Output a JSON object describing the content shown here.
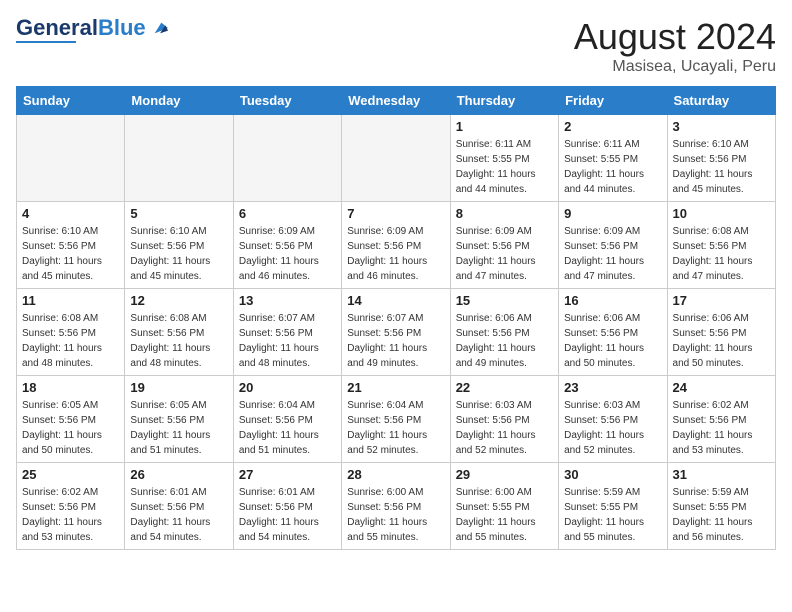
{
  "header": {
    "logo_line1": "General",
    "logo_line2": "Blue",
    "title": "August 2024",
    "subtitle": "Masisea, Ucayali, Peru"
  },
  "days_of_week": [
    "Sunday",
    "Monday",
    "Tuesday",
    "Wednesday",
    "Thursday",
    "Friday",
    "Saturday"
  ],
  "weeks": [
    [
      {
        "day": "",
        "empty": true
      },
      {
        "day": "",
        "empty": true
      },
      {
        "day": "",
        "empty": true
      },
      {
        "day": "",
        "empty": true
      },
      {
        "day": "1",
        "sunrise": "6:11 AM",
        "sunset": "5:55 PM",
        "daylight": "11 hours and 44 minutes."
      },
      {
        "day": "2",
        "sunrise": "6:11 AM",
        "sunset": "5:55 PM",
        "daylight": "11 hours and 44 minutes."
      },
      {
        "day": "3",
        "sunrise": "6:10 AM",
        "sunset": "5:56 PM",
        "daylight": "11 hours and 45 minutes."
      }
    ],
    [
      {
        "day": "4",
        "sunrise": "6:10 AM",
        "sunset": "5:56 PM",
        "daylight": "11 hours and 45 minutes."
      },
      {
        "day": "5",
        "sunrise": "6:10 AM",
        "sunset": "5:56 PM",
        "daylight": "11 hours and 45 minutes."
      },
      {
        "day": "6",
        "sunrise": "6:09 AM",
        "sunset": "5:56 PM",
        "daylight": "11 hours and 46 minutes."
      },
      {
        "day": "7",
        "sunrise": "6:09 AM",
        "sunset": "5:56 PM",
        "daylight": "11 hours and 46 minutes."
      },
      {
        "day": "8",
        "sunrise": "6:09 AM",
        "sunset": "5:56 PM",
        "daylight": "11 hours and 47 minutes."
      },
      {
        "day": "9",
        "sunrise": "6:09 AM",
        "sunset": "5:56 PM",
        "daylight": "11 hours and 47 minutes."
      },
      {
        "day": "10",
        "sunrise": "6:08 AM",
        "sunset": "5:56 PM",
        "daylight": "11 hours and 47 minutes."
      }
    ],
    [
      {
        "day": "11",
        "sunrise": "6:08 AM",
        "sunset": "5:56 PM",
        "daylight": "11 hours and 48 minutes."
      },
      {
        "day": "12",
        "sunrise": "6:08 AM",
        "sunset": "5:56 PM",
        "daylight": "11 hours and 48 minutes."
      },
      {
        "day": "13",
        "sunrise": "6:07 AM",
        "sunset": "5:56 PM",
        "daylight": "11 hours and 48 minutes."
      },
      {
        "day": "14",
        "sunrise": "6:07 AM",
        "sunset": "5:56 PM",
        "daylight": "11 hours and 49 minutes."
      },
      {
        "day": "15",
        "sunrise": "6:06 AM",
        "sunset": "5:56 PM",
        "daylight": "11 hours and 49 minutes."
      },
      {
        "day": "16",
        "sunrise": "6:06 AM",
        "sunset": "5:56 PM",
        "daylight": "11 hours and 50 minutes."
      },
      {
        "day": "17",
        "sunrise": "6:06 AM",
        "sunset": "5:56 PM",
        "daylight": "11 hours and 50 minutes."
      }
    ],
    [
      {
        "day": "18",
        "sunrise": "6:05 AM",
        "sunset": "5:56 PM",
        "daylight": "11 hours and 50 minutes."
      },
      {
        "day": "19",
        "sunrise": "6:05 AM",
        "sunset": "5:56 PM",
        "daylight": "11 hours and 51 minutes."
      },
      {
        "day": "20",
        "sunrise": "6:04 AM",
        "sunset": "5:56 PM",
        "daylight": "11 hours and 51 minutes."
      },
      {
        "day": "21",
        "sunrise": "6:04 AM",
        "sunset": "5:56 PM",
        "daylight": "11 hours and 52 minutes."
      },
      {
        "day": "22",
        "sunrise": "6:03 AM",
        "sunset": "5:56 PM",
        "daylight": "11 hours and 52 minutes."
      },
      {
        "day": "23",
        "sunrise": "6:03 AM",
        "sunset": "5:56 PM",
        "daylight": "11 hours and 52 minutes."
      },
      {
        "day": "24",
        "sunrise": "6:02 AM",
        "sunset": "5:56 PM",
        "daylight": "11 hours and 53 minutes."
      }
    ],
    [
      {
        "day": "25",
        "sunrise": "6:02 AM",
        "sunset": "5:56 PM",
        "daylight": "11 hours and 53 minutes."
      },
      {
        "day": "26",
        "sunrise": "6:01 AM",
        "sunset": "5:56 PM",
        "daylight": "11 hours and 54 minutes."
      },
      {
        "day": "27",
        "sunrise": "6:01 AM",
        "sunset": "5:56 PM",
        "daylight": "11 hours and 54 minutes."
      },
      {
        "day": "28",
        "sunrise": "6:00 AM",
        "sunset": "5:56 PM",
        "daylight": "11 hours and 55 minutes."
      },
      {
        "day": "29",
        "sunrise": "6:00 AM",
        "sunset": "5:55 PM",
        "daylight": "11 hours and 55 minutes."
      },
      {
        "day": "30",
        "sunrise": "5:59 AM",
        "sunset": "5:55 PM",
        "daylight": "11 hours and 55 minutes."
      },
      {
        "day": "31",
        "sunrise": "5:59 AM",
        "sunset": "5:55 PM",
        "daylight": "11 hours and 56 minutes."
      }
    ]
  ]
}
